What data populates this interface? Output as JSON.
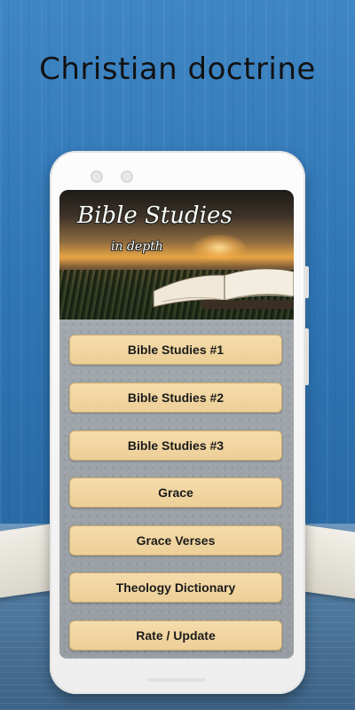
{
  "headline": "Christian doctrine",
  "banner": {
    "title": "Bible Studies",
    "subtitle": "in depth",
    "image": "sunset-field-open-bible"
  },
  "menu": {
    "items": [
      {
        "label": "Bible Studies #1"
      },
      {
        "label": "Bible Studies #2"
      },
      {
        "label": "Bible Studies #3"
      },
      {
        "label": "Grace"
      },
      {
        "label": "Grace Verses"
      },
      {
        "label": "Theology Dictionary"
      },
      {
        "label": "Rate / Update"
      }
    ]
  },
  "colors": {
    "background_blue": "#2f76b6",
    "button_fill": "#f1d5a0",
    "button_text": "#1b1b1b",
    "menu_bg": "#9ca2a7",
    "phone_body": "#f6f6f6"
  }
}
